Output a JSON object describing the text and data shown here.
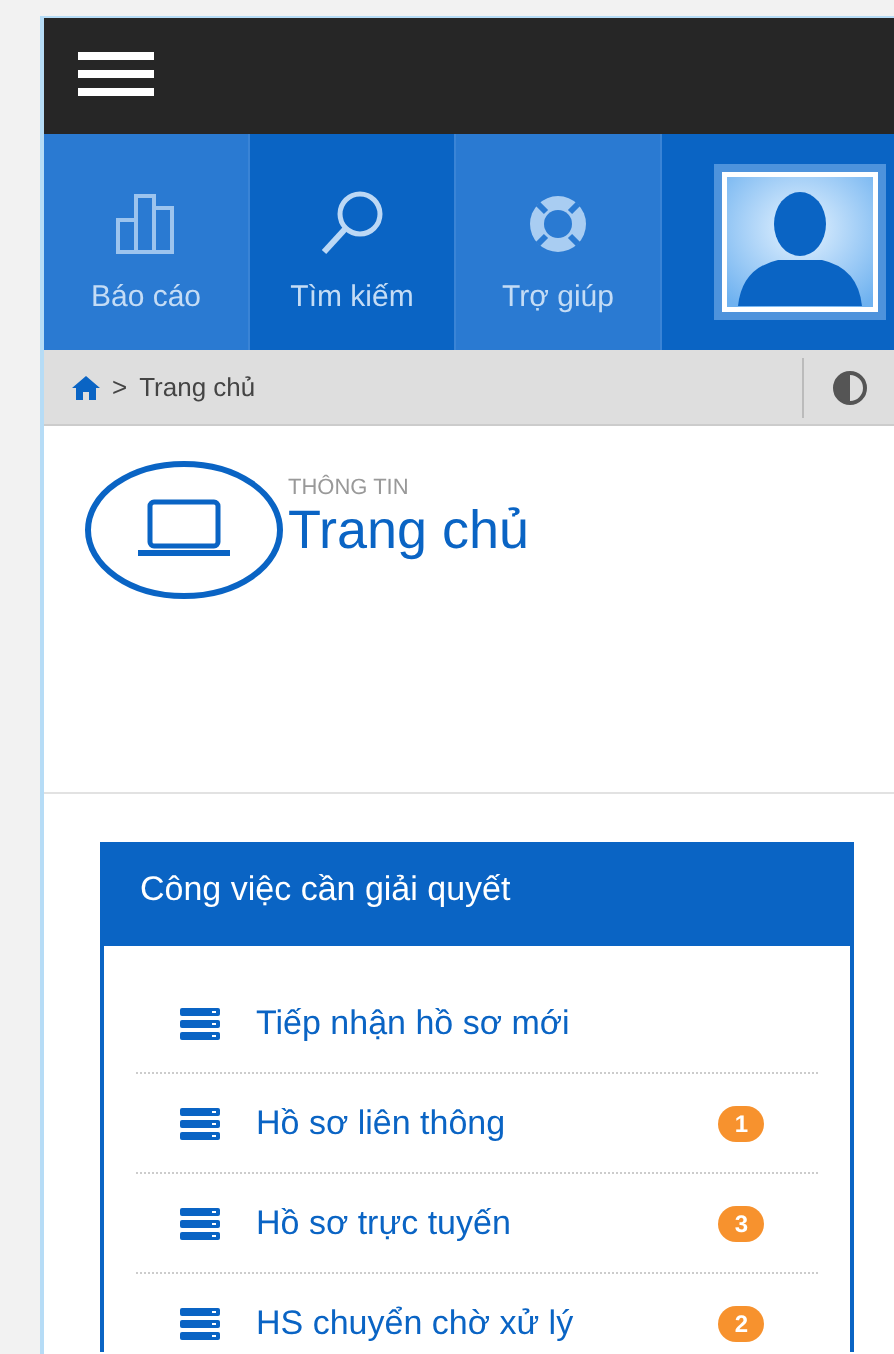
{
  "nav_tiles": [
    {
      "kind": "chart",
      "label": "Báo cáo"
    },
    {
      "kind": "search",
      "label": "Tìm kiếm"
    },
    {
      "kind": "help",
      "label": "Trợ giúp"
    }
  ],
  "breadcrumb": {
    "separator": ">",
    "current": "Trang chủ"
  },
  "page_header": {
    "subtitle": "THÔNG TIN",
    "title": "Trang chủ"
  },
  "task_panel": {
    "title": "Công việc cần giải quyết",
    "items": [
      {
        "label": "Tiếp nhận hồ sơ mới"
      },
      {
        "label": "Hồ sơ liên thông",
        "badge": "1"
      },
      {
        "label": "Hồ sơ trực tuyến",
        "badge": "3"
      },
      {
        "label": "HS chuyển chờ xử lý",
        "badge": "2"
      }
    ]
  }
}
